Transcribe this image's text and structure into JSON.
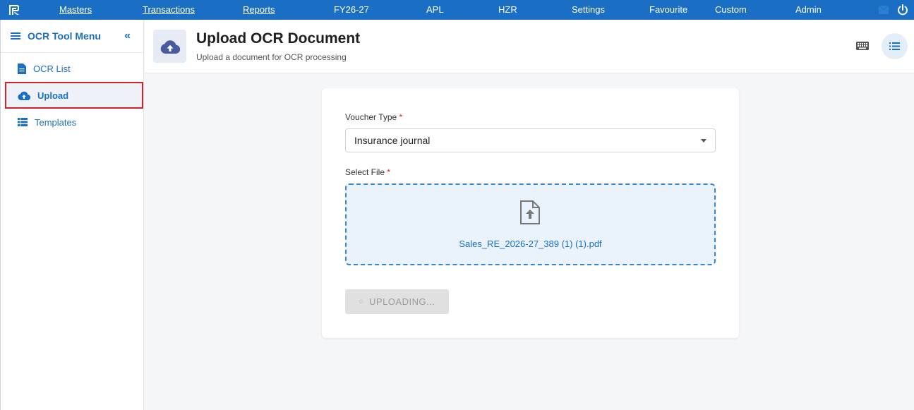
{
  "topnav": {
    "items": [
      "Masters",
      "Transactions",
      "Reports",
      "FY26-27",
      "APL",
      "HZR",
      "Settings",
      "Favourite",
      "Custom",
      "Admin"
    ]
  },
  "sidebar": {
    "title": "OCR Tool Menu",
    "items": [
      {
        "label": "OCR List",
        "icon": "document-icon"
      },
      {
        "label": "Upload",
        "icon": "cloud-upload-icon",
        "active": true
      },
      {
        "label": "Templates",
        "icon": "list-icon"
      }
    ]
  },
  "header": {
    "title": "Upload OCR Document",
    "subtitle": "Upload a document for OCR processing"
  },
  "form": {
    "voucher_label": "Voucher Type",
    "voucher_value": "Insurance journal",
    "file_label": "Select File",
    "required_mark": "*",
    "file_name": "Sales_RE_2026-27_389 (1) (1).pdf",
    "upload_button": "UPLOADING..."
  },
  "colors": {
    "brand": "#1a6fc4",
    "active_outline": "#d3222a",
    "dropzone_bg": "#eaf3fb"
  }
}
